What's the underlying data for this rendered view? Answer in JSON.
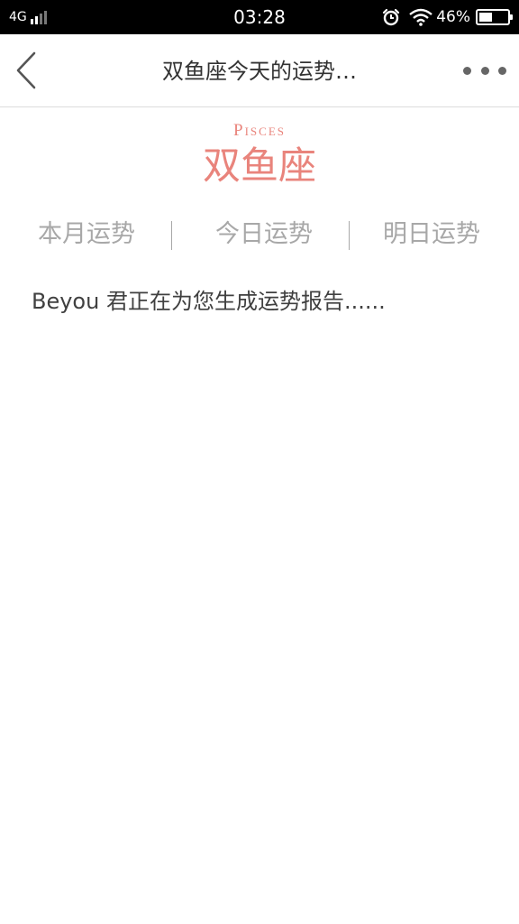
{
  "status_bar": {
    "network": "4G",
    "time": "03:28",
    "battery_percent": "46%",
    "battery_level": 0.46,
    "icons": [
      "signal-icon",
      "alarm-icon",
      "wifi-icon",
      "battery-icon"
    ]
  },
  "nav": {
    "title": "双鱼座今天的运势…",
    "icons": [
      "back-icon",
      "more-icon"
    ]
  },
  "sign": {
    "english": "Pisces",
    "chinese": "双鱼座",
    "accent_color": "#e9847c"
  },
  "tabs": [
    {
      "label": "本月运势"
    },
    {
      "label": "今日运势"
    },
    {
      "label": "明日运势"
    }
  ],
  "content": {
    "message": "Beyou 君正在为您生成运势报告......"
  }
}
